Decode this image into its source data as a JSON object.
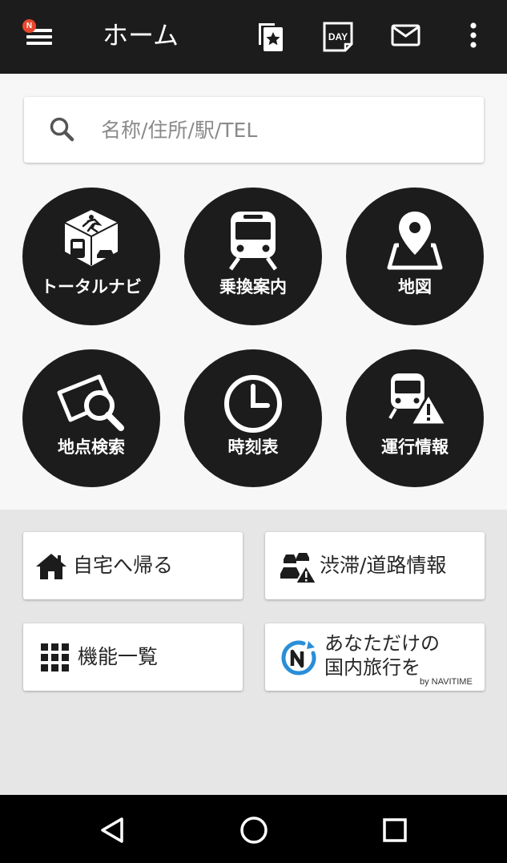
{
  "app_bar": {
    "title": "ホーム",
    "menu_badge": "N",
    "day_icon_text": "DAY",
    "actions": [
      "favorites-icon",
      "day-icon",
      "mail-icon",
      "more-vert-icon"
    ]
  },
  "search": {
    "placeholder": "名称/住所/駅/TEL"
  },
  "main_menu": [
    {
      "label": "トータルナビ",
      "icon": "total-navi-icon"
    },
    {
      "label": "乗換案内",
      "icon": "train-icon"
    },
    {
      "label": "地図",
      "icon": "map-pin-icon"
    },
    {
      "label": "地点検索",
      "icon": "place-search-icon"
    },
    {
      "label": "時刻表",
      "icon": "clock-icon"
    },
    {
      "label": "運行情報",
      "icon": "train-warning-icon"
    }
  ],
  "shortcuts": [
    {
      "label": "自宅へ帰る",
      "icon": "home-icon"
    },
    {
      "label": "渋滞/道路情報",
      "icon": "traffic-warning-icon"
    },
    {
      "label": "機能一覧",
      "icon": "grid-icon"
    }
  ],
  "promo": {
    "line1": "あなただけの",
    "line2": "国内旅行を",
    "byline": "by NAVITIME",
    "icon": "navitime-n-icon",
    "accent": "#2a8ed8"
  },
  "nav_bar": [
    "back-icon",
    "home-circle-icon",
    "recents-icon"
  ],
  "colors": {
    "app_bar": "#1c1c1c",
    "circle": "#1c1c1c",
    "badge": "#e8482f",
    "background": "#e6e6e6"
  }
}
